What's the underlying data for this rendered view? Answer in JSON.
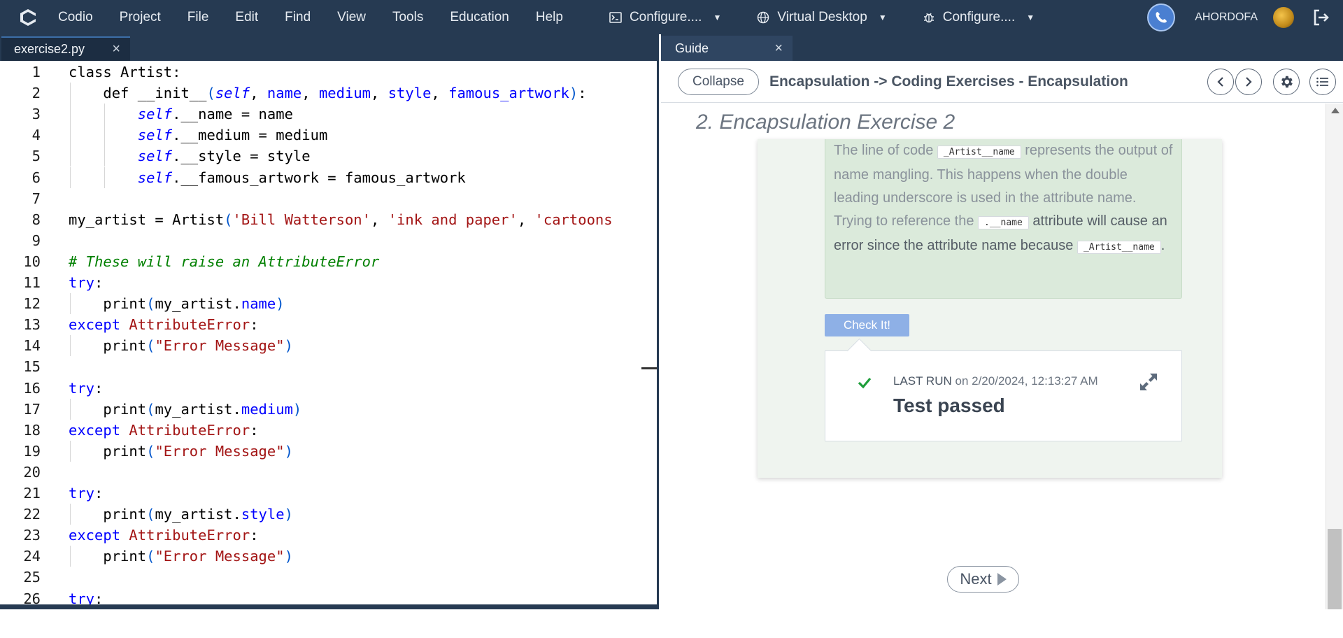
{
  "menubar": {
    "items": [
      "Codio",
      "Project",
      "File",
      "Edit",
      "Find",
      "View",
      "Tools",
      "Education",
      "Help"
    ],
    "tools": [
      {
        "icon": "terminal-icon",
        "label": "Configure...."
      },
      {
        "icon": "globe-icon",
        "label": "Virtual Desktop"
      },
      {
        "icon": "bug-icon",
        "label": "Configure...."
      }
    ],
    "username": "AHORDOFA"
  },
  "editor": {
    "tab_label": "exercise2.py",
    "lines": [
      "class Artist:",
      "    def __init__(self, name, medium, style, famous_artwork):",
      "        self.__name = name",
      "        self.__medium = medium",
      "        self.__style = style",
      "        self.__famous_artwork = famous_artwork",
      "",
      "my_artist = Artist('Bill Watterson', 'ink and paper', 'cartoons",
      "",
      "# These will raise an AttributeError",
      "try:",
      "    print(my_artist.name)",
      "except AttributeError:",
      "    print(\"Error Message\")",
      "",
      "try:",
      "    print(my_artist.medium)",
      "except AttributeError:",
      "    print(\"Error Message\")",
      "",
      "try:",
      "    print(my_artist.style)",
      "except AttributeError:",
      "    print(\"Error Message\")",
      "",
      "try:"
    ]
  },
  "guide": {
    "tab_label": "Guide",
    "collapse_label": "Collapse",
    "title": "Encapsulation -> Coding Exercises - Encapsulation",
    "section_title": "2. Encapsulation Exercise 2",
    "answer": {
      "part1": "The line of code",
      "tok1": "_Artist__name",
      "part2": "represents the output of name mangling. This happens when the double leading underscore is used in the attribute name. Trying to reference the",
      "tok2": ".__name",
      "part3": "attribute will cause an error since the attribute name because",
      "tok3": "_Artist__name",
      "part4": "."
    },
    "check_label": "Check It!",
    "result": {
      "last_run_label": "LAST RUN",
      "last_run_on": "on 2/20/2024, 12:13:27 AM",
      "status": "Test passed"
    },
    "next_label": "Next"
  },
  "colors": {
    "menubar_bg": "#263a52",
    "accent_blue": "#4a7fd1",
    "check_button": "#8eb0e6",
    "pass_green": "#1e9e3a"
  }
}
